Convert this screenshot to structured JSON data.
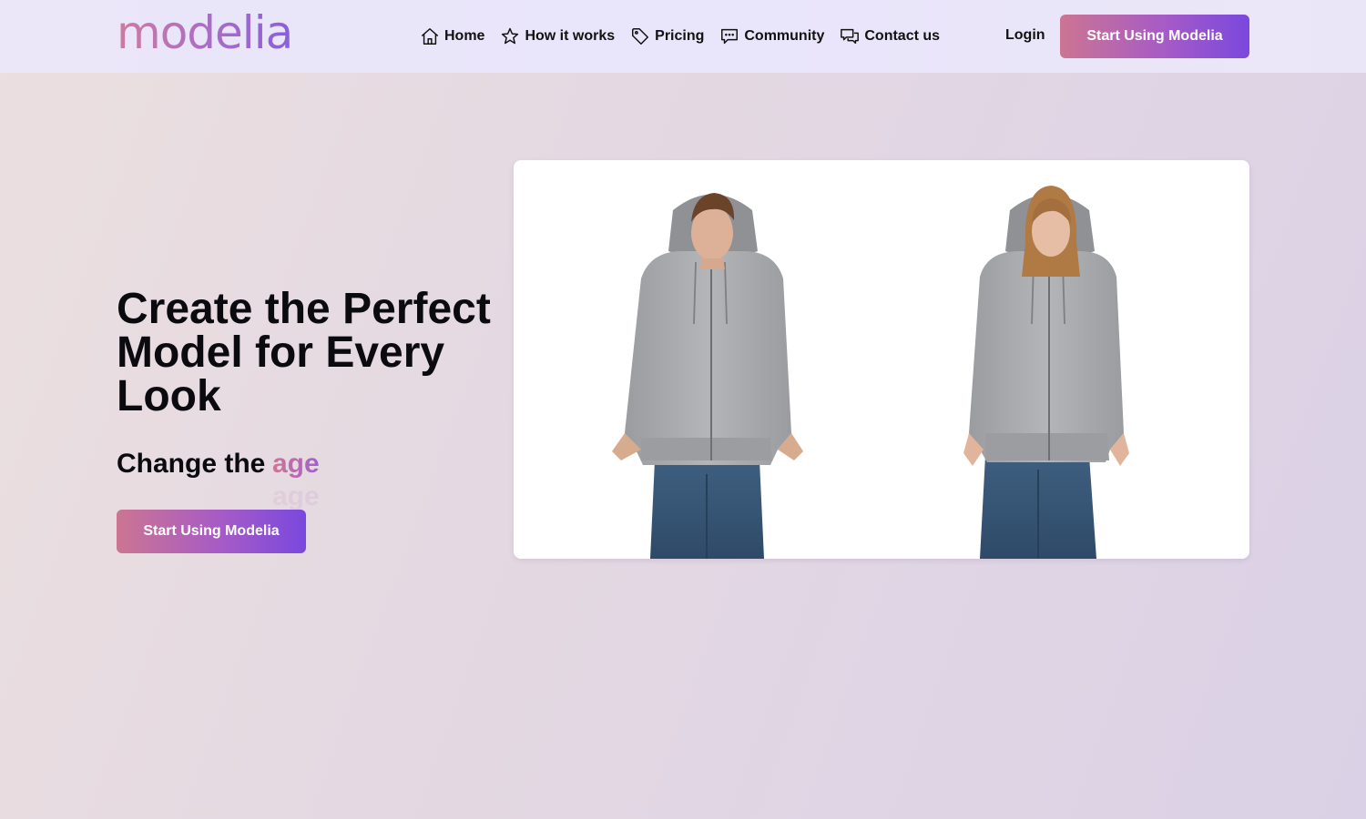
{
  "header": {
    "logo": "modelia",
    "nav": [
      {
        "label": "Home",
        "icon": "home-icon"
      },
      {
        "label": "How it works",
        "icon": "star-icon"
      },
      {
        "label": "Pricing",
        "icon": "tag-icon"
      },
      {
        "label": "Community",
        "icon": "chat-bubble-icon"
      },
      {
        "label": "Contact us",
        "icon": "chat-bubbles-icon"
      }
    ],
    "login_label": "Login",
    "cta_label": "Start Using Modelia"
  },
  "hero": {
    "title": "Create the Perfect Model for Every Look",
    "subtitle_prefix": "Change the",
    "rotating_word": "age",
    "rotating_word_next": "age",
    "cta_label": "Start Using Modelia"
  },
  "showcase": {
    "models": [
      {
        "name": "male-model",
        "top": "grey zip hoodie",
        "bottom": "blue jeans"
      },
      {
        "name": "female-model",
        "top": "grey zip hoodie",
        "bottom": "blue jeans"
      }
    ]
  },
  "colors": {
    "accent_start": "#cc7592",
    "accent_end": "#7a48de",
    "header_bg": "#e9e5fb"
  }
}
